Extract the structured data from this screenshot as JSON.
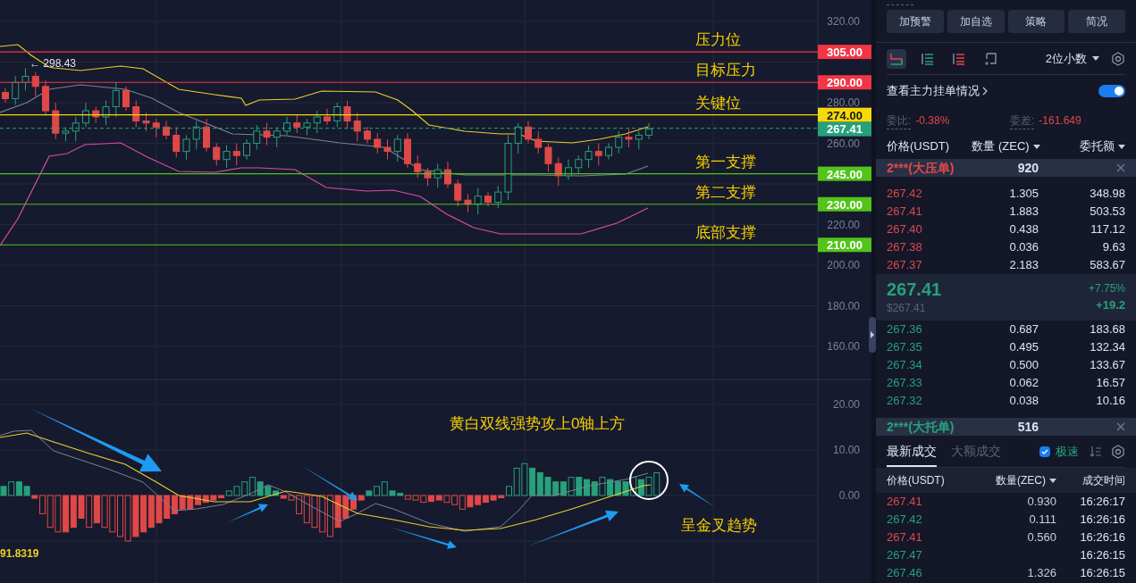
{
  "chart": {
    "axis_labels": [
      "320.00",
      "280.00",
      "260.00",
      "220.00",
      "200.00",
      "180.00",
      "160.00"
    ],
    "macd_axis_labels": [
      "20.00",
      "10.00",
      "0.00"
    ],
    "high_marker": "← 298.43",
    "price_levels": [
      {
        "price": "305.00",
        "color": "#f23645",
        "note": "压力位"
      },
      {
        "price": "290.00",
        "color": "#f23645",
        "note": "目标压力"
      },
      {
        "price": "274.00",
        "color": "#f5d90a",
        "note": "关键位"
      },
      {
        "price": "245.00",
        "color": "#52c41a",
        "note": "第一支撑"
      },
      {
        "price": "230.00",
        "color": "#52c41a",
        "note": "第二支撑"
      },
      {
        "price": "210.00",
        "color": "#52c41a",
        "note": "底部支撑"
      }
    ],
    "current_price": "267.41",
    "macd_value": "91.8319",
    "annotations": [
      "黄白双线强势攻上0轴上方",
      "呈金叉趋势"
    ]
  },
  "panel": {
    "buttons": [
      "加预警",
      "加自选",
      "策略",
      "简况"
    ],
    "view_modes": [
      {
        "kind": "split",
        "selected": true
      },
      {
        "kind": "bids",
        "selected": false
      },
      {
        "kind": "asks",
        "selected": false
      },
      {
        "kind": "custom",
        "selected": false
      }
    ],
    "decimals": "2位小数",
    "main_orders": {
      "label": "查看主力挂单情况",
      "on": true
    },
    "ratio": {
      "label": "委比:",
      "value": "-0.38%"
    },
    "diff": {
      "label": "委差:",
      "value": "-161.649"
    },
    "book_columns": [
      "价格(USDT)",
      "数量 (ZEC)",
      "委托额"
    ],
    "big_ask": {
      "label": "2***(大压单)",
      "qty": "920"
    },
    "asks": [
      {
        "price": "267.42",
        "qty": "1.305",
        "total": "348.98"
      },
      {
        "price": "267.41",
        "qty": "1.883",
        "total": "503.53"
      },
      {
        "price": "267.40",
        "qty": "0.438",
        "total": "117.12"
      },
      {
        "price": "267.38",
        "qty": "0.036",
        "total": "9.63"
      },
      {
        "price": "267.37",
        "qty": "2.183",
        "total": "583.67"
      }
    ],
    "last": {
      "price": "267.41",
      "usd": "$267.41",
      "pct": "+7.75%",
      "change": "+19.2"
    },
    "bids": [
      {
        "price": "267.36",
        "qty": "0.687",
        "total": "183.68"
      },
      {
        "price": "267.35",
        "qty": "0.495",
        "total": "132.34"
      },
      {
        "price": "267.34",
        "qty": "0.500",
        "total": "133.67"
      },
      {
        "price": "267.33",
        "qty": "0.062",
        "total": "16.57"
      },
      {
        "price": "267.32",
        "qty": "0.038",
        "total": "10.16"
      }
    ],
    "big_bid": {
      "label": "2***(大托单)",
      "qty": "516"
    },
    "trade_tabs": [
      {
        "label": "最新成交",
        "selected": true
      },
      {
        "label": "大额成交",
        "selected": false
      }
    ],
    "fast": {
      "label": "极速",
      "checked": true
    },
    "trade_columns": [
      "价格(USDT)",
      "数量(ZEC)",
      "成交时间"
    ],
    "trades": [
      {
        "price": "267.41",
        "qty": "0.930",
        "time": "16:26:17",
        "color": "#e04848"
      },
      {
        "price": "267.42",
        "qty": "0.111",
        "time": "16:26:16",
        "color": "#26a17b"
      },
      {
        "price": "267.41",
        "qty": "0.560",
        "time": "16:26:16",
        "color": "#e04848"
      },
      {
        "price": "267.47",
        "time": "16:26:15",
        "color": "#26a17b"
      },
      {
        "price": "267.46",
        "qty": "1.326",
        "time": "16:26:15",
        "color": "#26a17b"
      }
    ]
  }
}
